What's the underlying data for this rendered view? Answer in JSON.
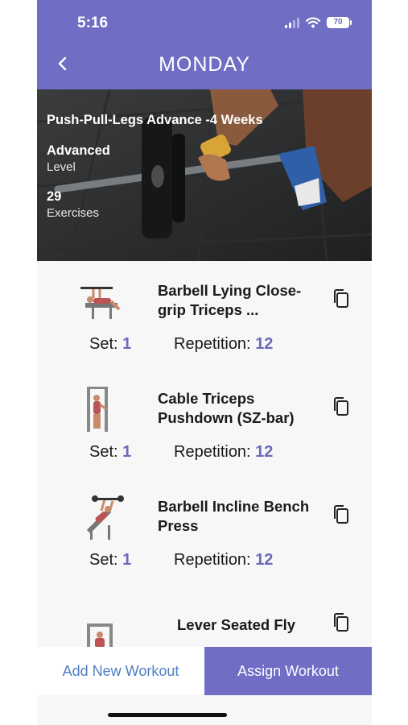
{
  "status_bar": {
    "time": "5:16",
    "battery": "70"
  },
  "header": {
    "title": "MONDAY",
    "back_icon": "chevron-left-icon"
  },
  "program": {
    "name": "Push-Pull-Legs Advance -4 Weeks",
    "level_value": "Advanced",
    "level_label": "Level",
    "exercise_count": "29",
    "exercise_label": "Exercises"
  },
  "exercises": [
    {
      "name": "Barbell Lying Close-grip Triceps ...",
      "set_label": "Set:",
      "set": "1",
      "rep_label": "Repetition:",
      "rep": "12"
    },
    {
      "name": "Cable Triceps Pushdown (SZ-bar)",
      "set_label": "Set:",
      "set": "1",
      "rep_label": "Repetition:",
      "rep": "12"
    },
    {
      "name": "Barbell Incline Bench Press",
      "set_label": "Set:",
      "set": "1",
      "rep_label": "Repetition:",
      "rep": "12"
    },
    {
      "name": "Lever Seated Fly"
    }
  ],
  "buttons": {
    "add": "Add New Workout",
    "assign": "Assign Workout"
  },
  "colors": {
    "accent": "#6f6dc4",
    "number": "#6c6ab8",
    "link": "#4f7fc4"
  }
}
